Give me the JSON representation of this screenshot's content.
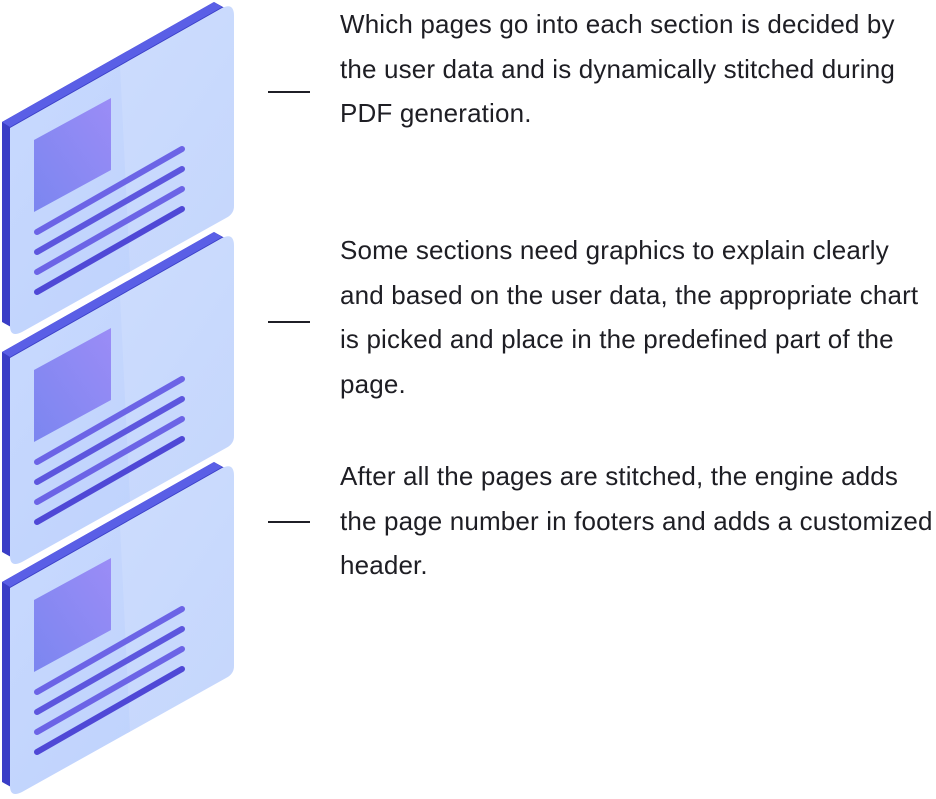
{
  "colors": {
    "panel_face": "#c4d6fd",
    "panel_edge": "#4a4fd8",
    "panel_edge_dark": "#3236b8",
    "image_block": "#8f87f3",
    "lines": "#5a55e0",
    "text": "#1e1e24"
  },
  "icons": [
    "document-page-icon",
    "document-page-icon",
    "document-page-icon"
  ],
  "steps": [
    {
      "text": "Which pages go into each section is decided by the user data and is dynamically stitched during PDF generation."
    },
    {
      "text": "Some sections need graphics to explain clearly and based on the user data, the appropriate chart is picked and place in the predefined part of the page."
    },
    {
      "text": "After all the pages are stitched, the engine adds the page number in footers and adds a customized header."
    }
  ]
}
